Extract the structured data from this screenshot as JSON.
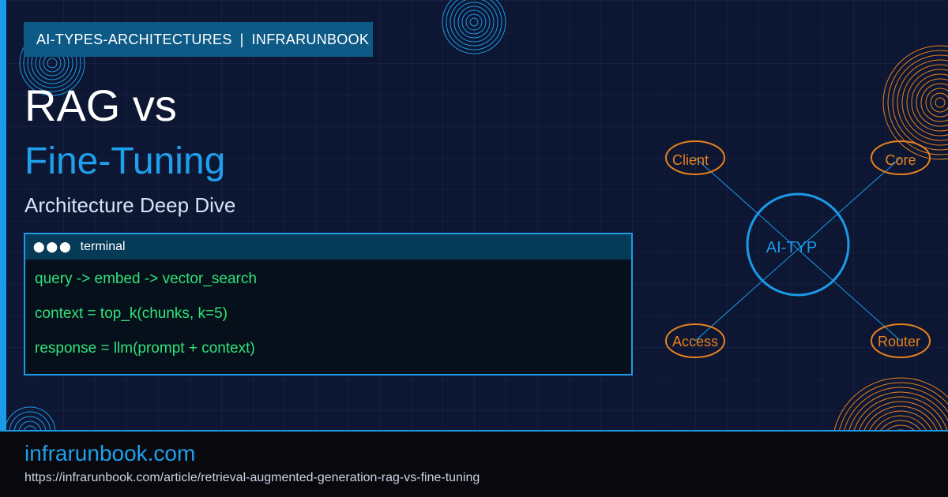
{
  "tag": {
    "category": "AI-TYPES-ARCHITECTURES",
    "separator": "|",
    "brand": "INFRARUNBOOK"
  },
  "title": {
    "line1": "RAG vs",
    "line2": "Fine-Tuning",
    "subtitle": "Architecture Deep Dive"
  },
  "terminal": {
    "dots": "⬤⬤⬤",
    "label": "terminal",
    "lines": [
      "query -> embed -> vector_search",
      "context = top_k(chunks, k=5)",
      "response = llm(prompt + context)"
    ]
  },
  "diagram": {
    "center": "AI-TYP",
    "nodes": {
      "client": "Client",
      "core": "Core",
      "access": "Access",
      "router": "Router"
    }
  },
  "footer": {
    "domain": "infrarunbook.com",
    "url": "https://infrarunbook.com/article/retrieval-augmented-generation-rag-vs-fine-tuning"
  },
  "colors": {
    "background": "#0d1632",
    "accent_blue": "#1a9be8",
    "accent_orange": "#e8821e",
    "code_green": "#2fe27a"
  }
}
